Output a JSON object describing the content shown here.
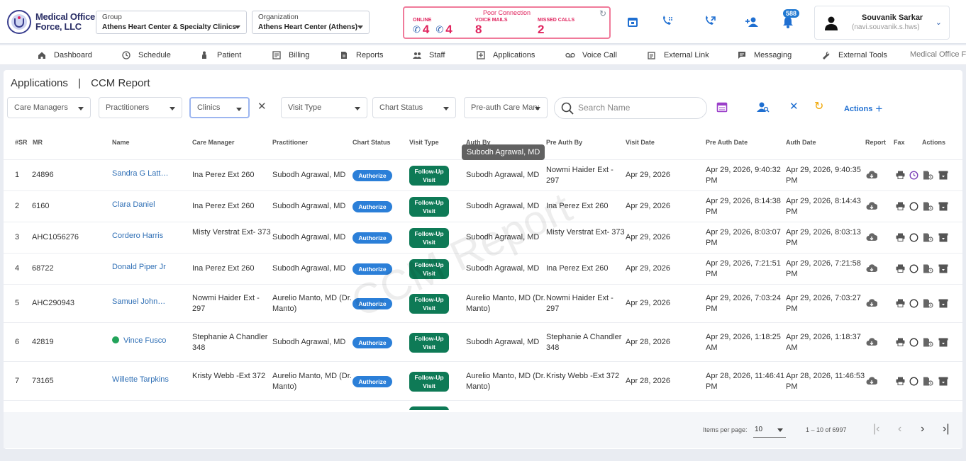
{
  "logo": {
    "line1": "Medical Office",
    "line2": "Force, LLC"
  },
  "group": {
    "label": "Group",
    "value": "Athens Heart Center & Specialty Clinics"
  },
  "organization": {
    "label": "Organization",
    "value": "Athens Heart Center (Athens)"
  },
  "connection": {
    "status": "Poor Connection",
    "online_label": "ONLINE",
    "online_a": "4",
    "online_b": "4",
    "voicemail_label": "VOICE MAILS",
    "voicemail_value": "8",
    "missed_label": "MISSED CALLS",
    "missed_value": "2"
  },
  "notifications": {
    "count": "588"
  },
  "user": {
    "name": "Souvanik Sarkar",
    "email": "(navi.souvanik.s.hws)"
  },
  "nav": [
    {
      "label": "Dashboard",
      "icon": "home-icon"
    },
    {
      "label": "Schedule",
      "icon": "clock-icon"
    },
    {
      "label": "Patient",
      "icon": "patient-icon"
    },
    {
      "label": "Billing",
      "icon": "billing-icon"
    },
    {
      "label": "Reports",
      "icon": "report-icon"
    },
    {
      "label": "Staff",
      "icon": "staff-icon"
    },
    {
      "label": "Applications",
      "icon": "applications-icon"
    },
    {
      "label": "Voice Call",
      "icon": "voicemail-icon"
    },
    {
      "label": "External Link",
      "icon": "external-link-icon"
    },
    {
      "label": "Messaging",
      "icon": "message-icon"
    },
    {
      "label": "External Tools",
      "icon": "wrench-icon"
    },
    {
      "label": "Medical Office Fo",
      "icon": ""
    }
  ],
  "breadcrumb": {
    "root": "Applications",
    "sep": "|",
    "current": "CCM Report"
  },
  "filters": {
    "care_managers": "Care Managers",
    "practitioners": "Practitioners",
    "clinics": "Clinics",
    "visit_type": "Visit Type",
    "chart_status": "Chart Status",
    "preauth": "Pre-auth Care Mana",
    "search_placeholder": "Search Name",
    "actions": "Actions"
  },
  "columns": {
    "sr": "#SR",
    "mr": "MR",
    "name": "Name",
    "care_manager": "Care Manager",
    "practitioner": "Practitioner",
    "chart_status": "Chart Status",
    "visit_type": "Visit Type",
    "auth_by": "Auth By",
    "pre_auth_by": "Pre Auth By",
    "visit_date": "Visit Date",
    "pre_auth_date": "Pre Auth Date",
    "auth_date": "Auth Date",
    "report": "Report",
    "fax": "Fax",
    "actions": "Actions"
  },
  "tooltip": "Subodh Agrawal, MD",
  "watermark": "CCM Report",
  "rows": [
    {
      "sr": "1",
      "mr": "24896",
      "name": "Sandra G Latt…",
      "care_manager": "Ina Perez Ext 260",
      "practitioner": "Subodh Agrawal, MD",
      "status": "Authorize",
      "visit": "Follow-Up Visit",
      "auth_by": "Subodh Agrawal, MD",
      "pre_auth_by": "Nowmi Haider Ext - 297",
      "visit_date": "Apr 29, 2026",
      "pre_auth_date": "Apr 29, 2026, 9:40:32 PM",
      "auth_date": "Apr 29, 2026, 9:40:35 PM",
      "online": false,
      "clock": true
    },
    {
      "sr": "2",
      "mr": "6160",
      "name": "Clara Daniel",
      "care_manager": "Ina Perez Ext 260",
      "practitioner": "Subodh Agrawal, MD",
      "status": "Authorize",
      "visit": "Follow-Up Visit",
      "auth_by": "Subodh Agrawal, MD",
      "pre_auth_by": "Ina Perez Ext 260",
      "visit_date": "Apr 29, 2026",
      "pre_auth_date": "Apr 29, 2026, 8:14:38 PM",
      "auth_date": "Apr 29, 2026, 8:14:43 PM",
      "online": false,
      "clock": false
    },
    {
      "sr": "3",
      "mr": "AHC1056276",
      "name": "Cordero Harris",
      "care_manager": "Misty Verstrat Ext- 373",
      "practitioner": "Subodh Agrawal, MD",
      "status": "Authorize",
      "visit": "Follow-Up Visit",
      "auth_by": "Subodh Agrawal, MD",
      "pre_auth_by": "Misty Verstrat Ext- 373",
      "visit_date": "Apr 29, 2026",
      "pre_auth_date": "Apr 29, 2026, 8:03:07 PM",
      "auth_date": "Apr 29, 2026, 8:03:13 PM",
      "online": false,
      "clock": false
    },
    {
      "sr": "4",
      "mr": "68722",
      "name": "Donald Piper Jr",
      "care_manager": "Ina Perez Ext 260",
      "practitioner": "Subodh Agrawal, MD",
      "status": "Authorize",
      "visit": "Follow-Up Visit",
      "auth_by": "Subodh Agrawal, MD",
      "pre_auth_by": "Ina Perez Ext 260",
      "visit_date": "Apr 29, 2026",
      "pre_auth_date": "Apr 29, 2026, 7:21:51 PM",
      "auth_date": "Apr 29, 2026, 7:21:58 PM",
      "online": false,
      "clock": false
    },
    {
      "sr": "5",
      "mr": "AHC290943",
      "name": "Samuel John…",
      "care_manager": "Nowmi Haider Ext - 297",
      "practitioner": "Aurelio Manto, MD (Dr. Manto)",
      "status": "Authorize",
      "visit": "Follow-Up Visit",
      "auth_by": "Aurelio Manto, MD (Dr. Manto)",
      "pre_auth_by": "Nowmi Haider Ext - 297",
      "visit_date": "Apr 29, 2026",
      "pre_auth_date": "Apr 29, 2026, 7:03:24 PM",
      "auth_date": "Apr 29, 2026, 7:03:27 PM",
      "online": false,
      "clock": false
    },
    {
      "sr": "6",
      "mr": "42819",
      "name": "Vince Fusco",
      "care_manager": "Stephanie A Chandler 348",
      "practitioner": "Subodh Agrawal, MD",
      "status": "Authorize",
      "visit": "Follow-Up Visit",
      "auth_by": "Subodh Agrawal, MD",
      "pre_auth_by": "Stephanie A Chandler 348",
      "visit_date": "Apr 28, 2026",
      "pre_auth_date": "Apr 29, 2026, 1:18:25 AM",
      "auth_date": "Apr 29, 2026, 1:18:37 AM",
      "online": true,
      "clock": false
    },
    {
      "sr": "7",
      "mr": "73165",
      "name": "Willette Tarpkins",
      "care_manager": "Kristy Webb -Ext 372",
      "practitioner": "Aurelio Manto, MD (Dr. Manto)",
      "status": "Authorize",
      "visit": "Follow-Up Visit",
      "auth_by": "Aurelio Manto, MD (Dr. Manto)",
      "pre_auth_by": "Kristy Webb -Ext 372",
      "visit_date": "Apr 28, 2026",
      "pre_auth_date": "Apr 28, 2026, 11:46:41 PM",
      "auth_date": "Apr 28, 2026, 11:46:53 PM",
      "online": false,
      "clock": false
    }
  ],
  "pagination": {
    "items_label": "Items per page:",
    "per_page": "10",
    "range": "1 – 10 of 6997"
  }
}
